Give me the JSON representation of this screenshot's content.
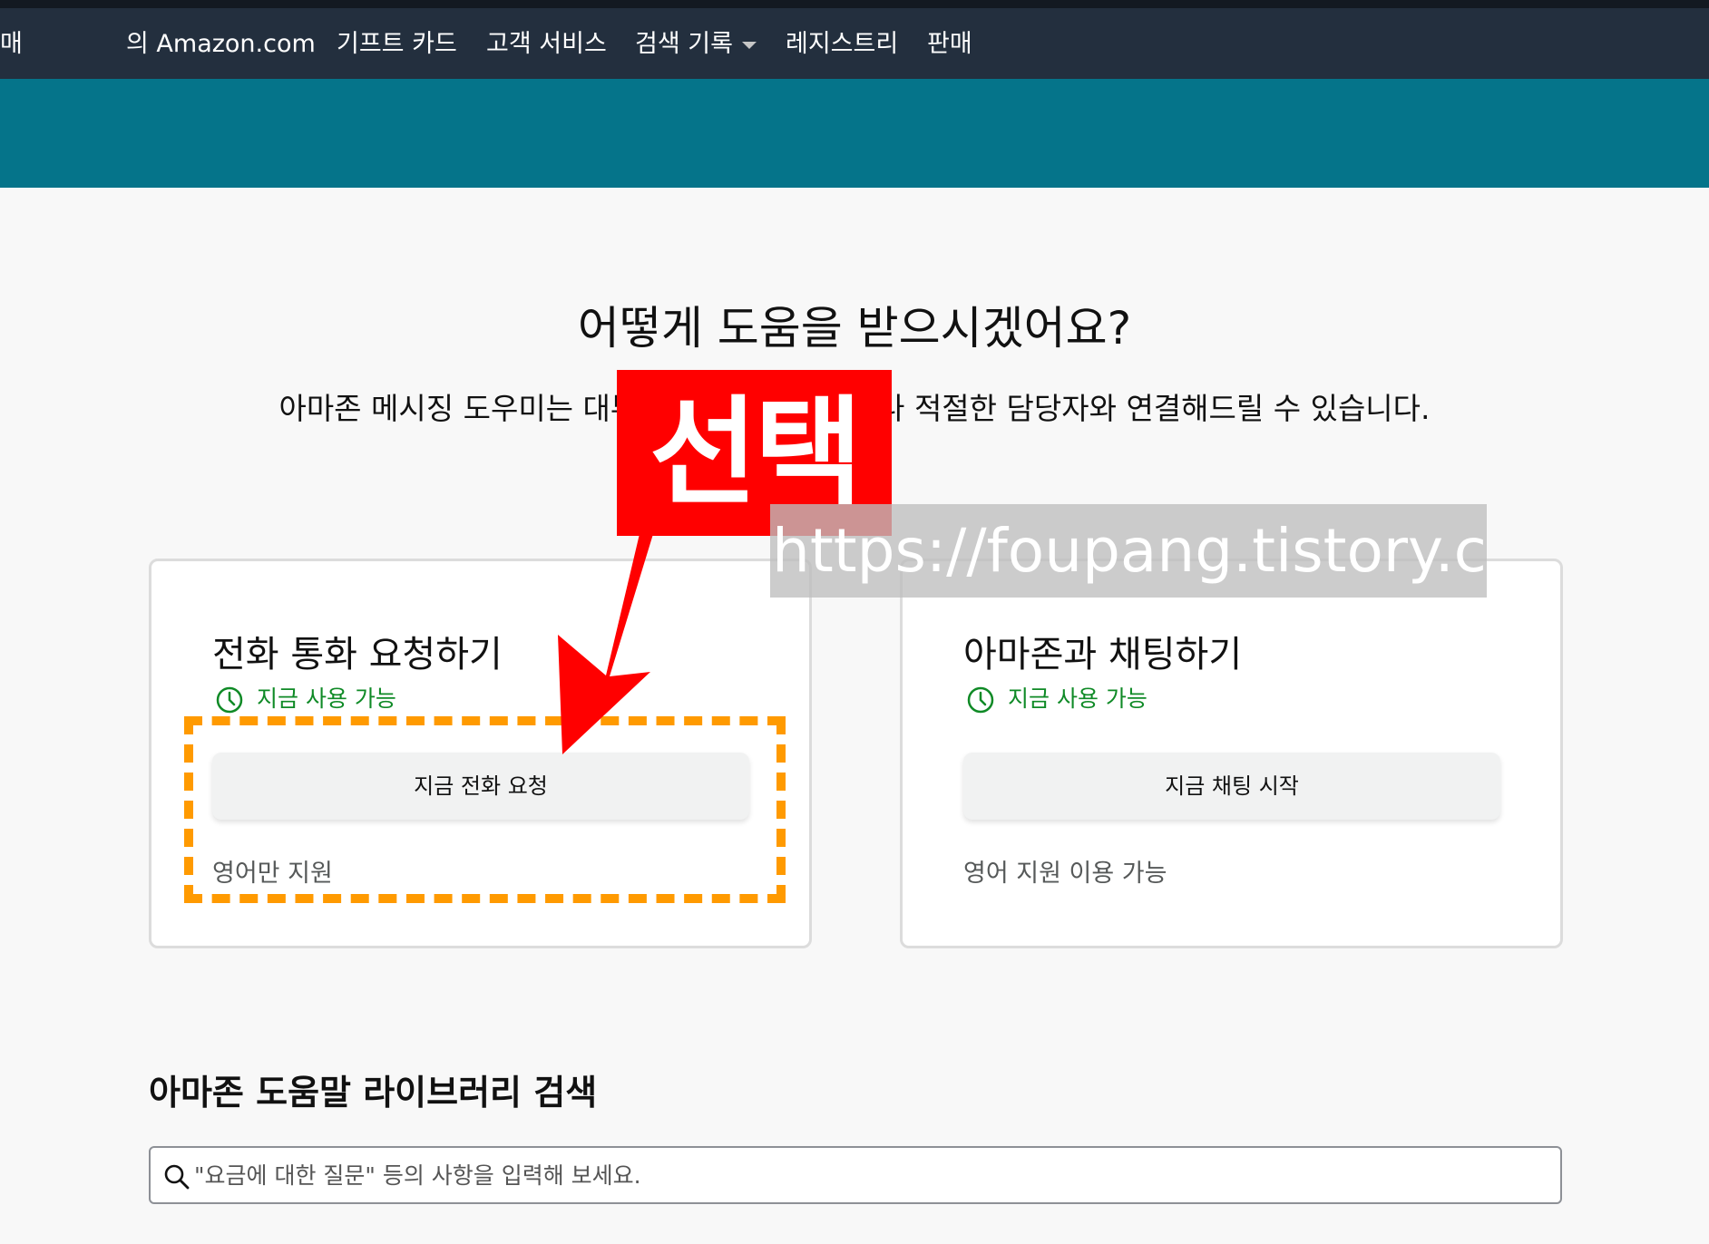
{
  "nav": {
    "cut_left": "매",
    "items": [
      {
        "label": "의 Amazon.com"
      },
      {
        "label": "기프트 카드"
      },
      {
        "label": "고객 서비스"
      },
      {
        "label": "검색 기록"
      },
      {
        "label": "레지스트리"
      },
      {
        "label": "판매"
      }
    ]
  },
  "main": {
    "title": "어떻게 도움을 받으시겠어요?",
    "subtitle": "아마존 메시징 도우미는 대부분의 질문에 답하거나 적절한 담당자와 연결해드릴 수 있습니다."
  },
  "cards": [
    {
      "title": "전화 통화 요청하기",
      "availability": "지금 사용 가능",
      "button": "지금 전화 요청",
      "note": "영어만 지원"
    },
    {
      "title": "아마존과 채팅하기",
      "availability": "지금 사용 가능",
      "button": "지금 채팅 시작",
      "note": "영어 지원 이용 가능"
    }
  ],
  "help": {
    "section_title": "아마존 도움말 라이브러리 검색",
    "search_placeholder": "\"요금에 대한 질문\" 등의 사항을 입력해 보세요."
  },
  "overlay": {
    "label": "선택",
    "watermark": "https://foupang.tistory.com"
  },
  "colors": {
    "topbar": "#232f3e",
    "hero": "#05748a",
    "available_green": "#0f8a26",
    "annotation_red": "#ff0000",
    "annotation_orange": "#ff9a00"
  }
}
